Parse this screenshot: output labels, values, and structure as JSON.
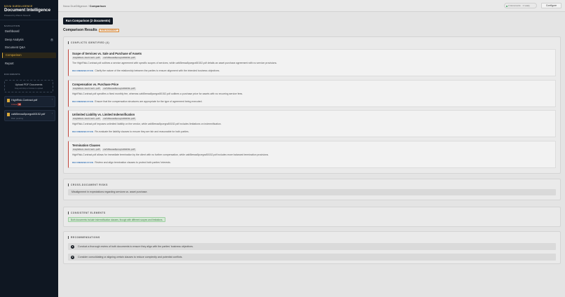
{
  "sidebar": {
    "brand_top": "NOVA DUEDILIGENCE",
    "brand_title": "Document Intelligence",
    "brand_sub": "Powered by Rhenix Nova AI",
    "nav_section": "NAVIGATION",
    "nav": [
      {
        "label": "Dashboard"
      },
      {
        "label": "Deep Analysis",
        "badge": "0"
      },
      {
        "label": "Document Q&A"
      },
      {
        "label": "Comparison",
        "active": true
      },
      {
        "label": "Report"
      }
    ],
    "docs_section": "DOCUMENTS",
    "upload_title": "Upload PDF Documents",
    "upload_sub": "Drag and drop or browse to upload",
    "documents": [
      {
        "name": "HighRisk-Contract.pdf",
        "risk_label": "Critical",
        "risk_score": "98"
      },
      {
        "name": "cafd5eeaa5pcegra50152.pdf",
        "tag": "Risk: pending"
      }
    ]
  },
  "topbar": {
    "crumb_root": "Nova DueDiligence",
    "crumb_sep": "/",
    "crumb_current": "Comparison",
    "status": "2 documents · 1 ready",
    "configure": "Configure"
  },
  "main": {
    "run_button": "Run Comparison (2 documents)",
    "results_title": "Comparison Results",
    "results_tag": "RISK ALIGNMENT",
    "conflicts_header": "CONFLICTS IDENTIFIED (4)",
    "rec_label": "RECOMMENDATION",
    "chip_a": "HighRisk-Contract.pdf",
    "chip_b": "cafd5eeaa5pcegra50152.pdf",
    "conflicts": [
      {
        "title": "Scope of Services vs. Sale and Purchase of Assets",
        "desc": "The HighRisk-Contract.pdf outlines a service agreement with specific scopes of services, while cafd5eeaa5pcegra50152.pdf details an asset purchase agreement with no service provisions.",
        "rec": "Clarify the nature of the relationship between the parties to ensure alignment with the intended business objectives."
      },
      {
        "title": "Compensation vs. Purchase Price",
        "desc": "HighRisk-Contract.pdf specifies a fixed monthly fee, whereas cafd5eeaa5pcegra50152.pdf outlines a purchase price for assets with no recurring service fees.",
        "rec": "Ensure that the compensation structures are appropriate for the type of agreement being executed."
      },
      {
        "title": "Unlimited Liability vs. Limited Indemnification",
        "desc": "HighRisk-Contract.pdf imposes unlimited liability on the vendor, while cafd5eeaa5pcegra50152.pdf includes limitations on indemnification.",
        "rec": "Re-evaluate the liability clauses to ensure they are fair and reasonable for both parties."
      },
      {
        "title": "Termination Clauses",
        "desc": "HighRisk-Contract.pdf allows for immediate termination by the client with no further compensation, while cafd5eeaa5pcegra50152.pdf includes more balanced termination provisions.",
        "rec": "Review and align termination clauses to protect both parties' interests."
      }
    ],
    "risks_header": "CROSS-DOCUMENT RISKS",
    "risks": [
      "Misalignment in expectations regarding services vs. asset purchase."
    ],
    "consistent_header": "CONSISTENT ELEMENTS",
    "consistent": [
      "Both documents include indemnification clauses, though with different scopes and limitations."
    ],
    "recs_header": "RECOMMENDATIONS",
    "recommendations": [
      {
        "num": "1",
        "text": "Conduct a thorough review of both documents to ensure they align with the parties' business objectives."
      },
      {
        "num": "2",
        "text": "Consider consolidating or aligning certain clauses to reduce complexity and potential conflicts."
      }
    ]
  }
}
